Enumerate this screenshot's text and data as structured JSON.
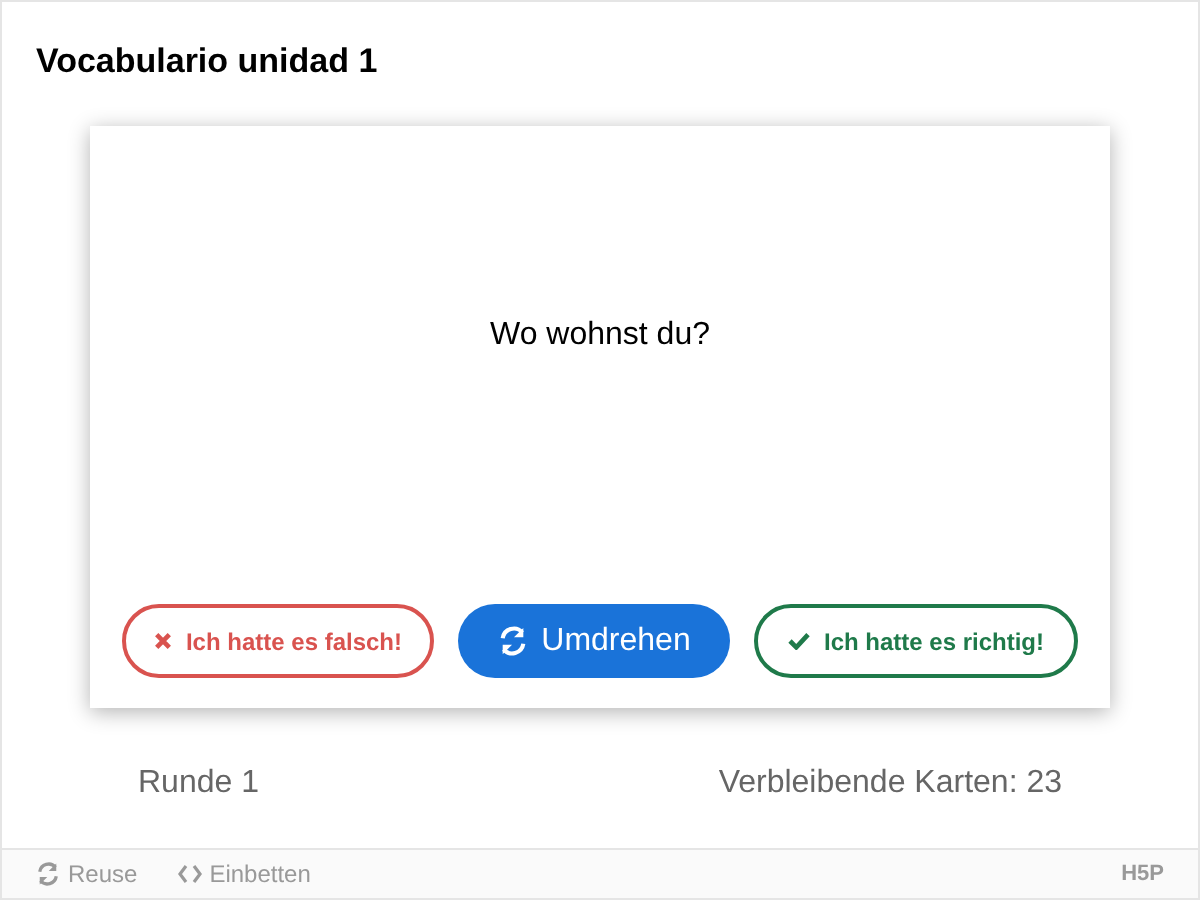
{
  "title": "Vocabulario unidad 1",
  "card": {
    "text": "Wo wohnst du?"
  },
  "buttons": [
    {
      "kind": "wrong",
      "label": "Ich hatte es falsch!"
    },
    {
      "kind": "flip",
      "label": "Umdrehen"
    },
    {
      "kind": "right",
      "label": "Ich hatte es richtig!"
    }
  ],
  "round": "Runde 1",
  "remaining": "Verbleibende Karten: 23",
  "footer": {
    "actions": [
      {
        "kind": "reuse",
        "label": "Reuse"
      },
      {
        "kind": "embed",
        "label": "Einbetten"
      }
    ],
    "logo": "H5P"
  }
}
